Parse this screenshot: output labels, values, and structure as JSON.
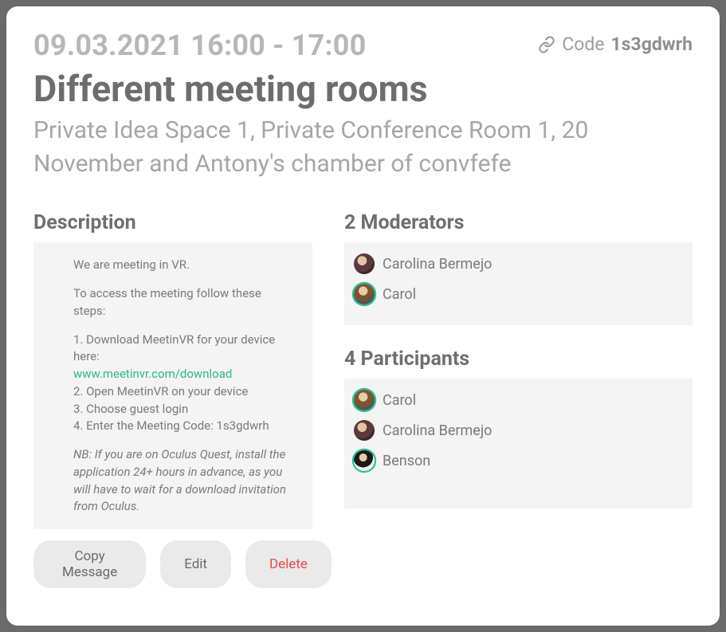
{
  "header": {
    "datetime": "09.03.2021 16:00 - 17:00",
    "code_label": "Code",
    "code_value": "1s3gdwrh",
    "title": "Different meeting rooms",
    "rooms": "Private Idea Space 1, Private Conference Room 1, 20 November and Antony's chamber of convfefe"
  },
  "description": {
    "heading": "Description",
    "intro": "We are meeting in VR.",
    "access_steps_lead": "To access the meeting follow these steps:",
    "step1_prefix": "1. Download MeetinVR for your device here:",
    "step1_link": "www.meetinvr.com/download",
    "step2": "2. Open MeetinVR on your device",
    "step3": "3. Choose guest login",
    "step4": "4. Enter the Meeting Code: 1s3gdwrh",
    "note": "NB: If you are on Oculus Quest, install the application 24+ hours in advance, as you will have to wait for a download invitation from Oculus."
  },
  "moderators": {
    "heading": "2 Moderators",
    "items": [
      {
        "name": "Carolina Bermejo",
        "avatar_class": "av-carolina",
        "ring": false
      },
      {
        "name": "Carol",
        "avatar_class": "av-carol",
        "ring": true
      }
    ]
  },
  "participants": {
    "heading": "4 Participants",
    "items": [
      {
        "name": "Carol",
        "avatar_class": "av-carol",
        "ring": true
      },
      {
        "name": "Carolina Bermejo",
        "avatar_class": "av-carolina",
        "ring": false
      },
      {
        "name": "Benson",
        "avatar_class": "av-benson",
        "ring": true
      }
    ]
  },
  "buttons": {
    "copy": "Copy Message",
    "edit": "Edit",
    "delete": "Delete"
  }
}
